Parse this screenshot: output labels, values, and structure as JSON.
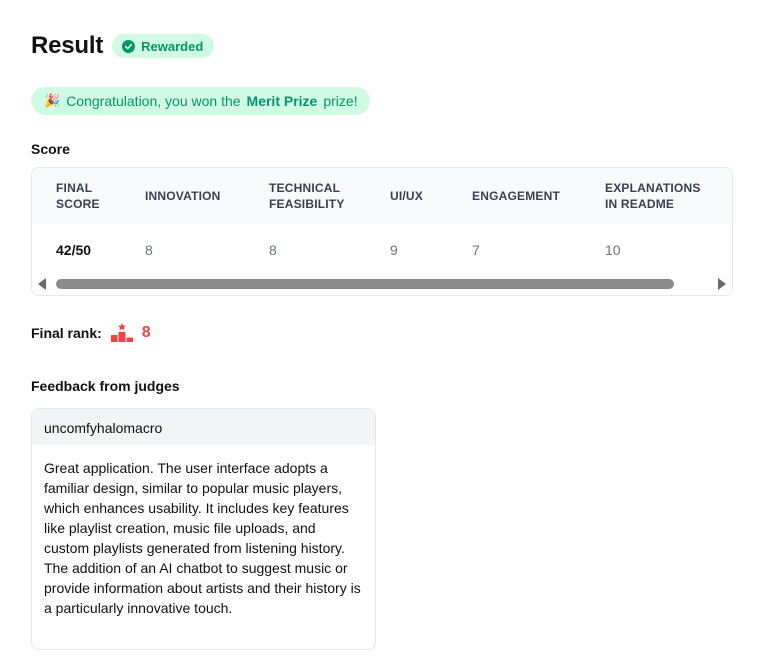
{
  "header": {
    "title": "Result",
    "badge": "Rewarded"
  },
  "congrats": {
    "emoji": "🎉",
    "prefix": "Congratulation, you won the",
    "prize": "Merit Prize",
    "suffix": "prize!"
  },
  "score": {
    "label": "Score",
    "columns": [
      {
        "line1": "FINAL",
        "line2": "SCORE",
        "value": "42/50"
      },
      {
        "line1": "INNOVATION",
        "line2": "",
        "value": "8"
      },
      {
        "line1": "TECHNICAL",
        "line2": "FEASIBILITY",
        "value": "8"
      },
      {
        "line1": "UI/UX",
        "line2": "",
        "value": "9"
      },
      {
        "line1": "ENGAGEMENT",
        "line2": "",
        "value": "7"
      },
      {
        "line1": "EXPLANATIONS",
        "line2": "IN README",
        "value": "10"
      }
    ]
  },
  "rank": {
    "label": "Final rank:",
    "value": "8",
    "icon": "podium-icon"
  },
  "feedback": {
    "label": "Feedback from judges",
    "judge": "uncomfyhalomacro",
    "text": "Great application. The user interface adopts a familiar design, similar to popular music players, which enhances usability. It includes key features like playlist creation, music file uploads, and custom playlists generated from listening history. The addition of an AI chatbot to suggest music or provide information about artists and their history is a particularly innovative touch."
  },
  "colors": {
    "success": "#059669",
    "success_bg": "#d1fae5",
    "rank": "#ef4444"
  }
}
